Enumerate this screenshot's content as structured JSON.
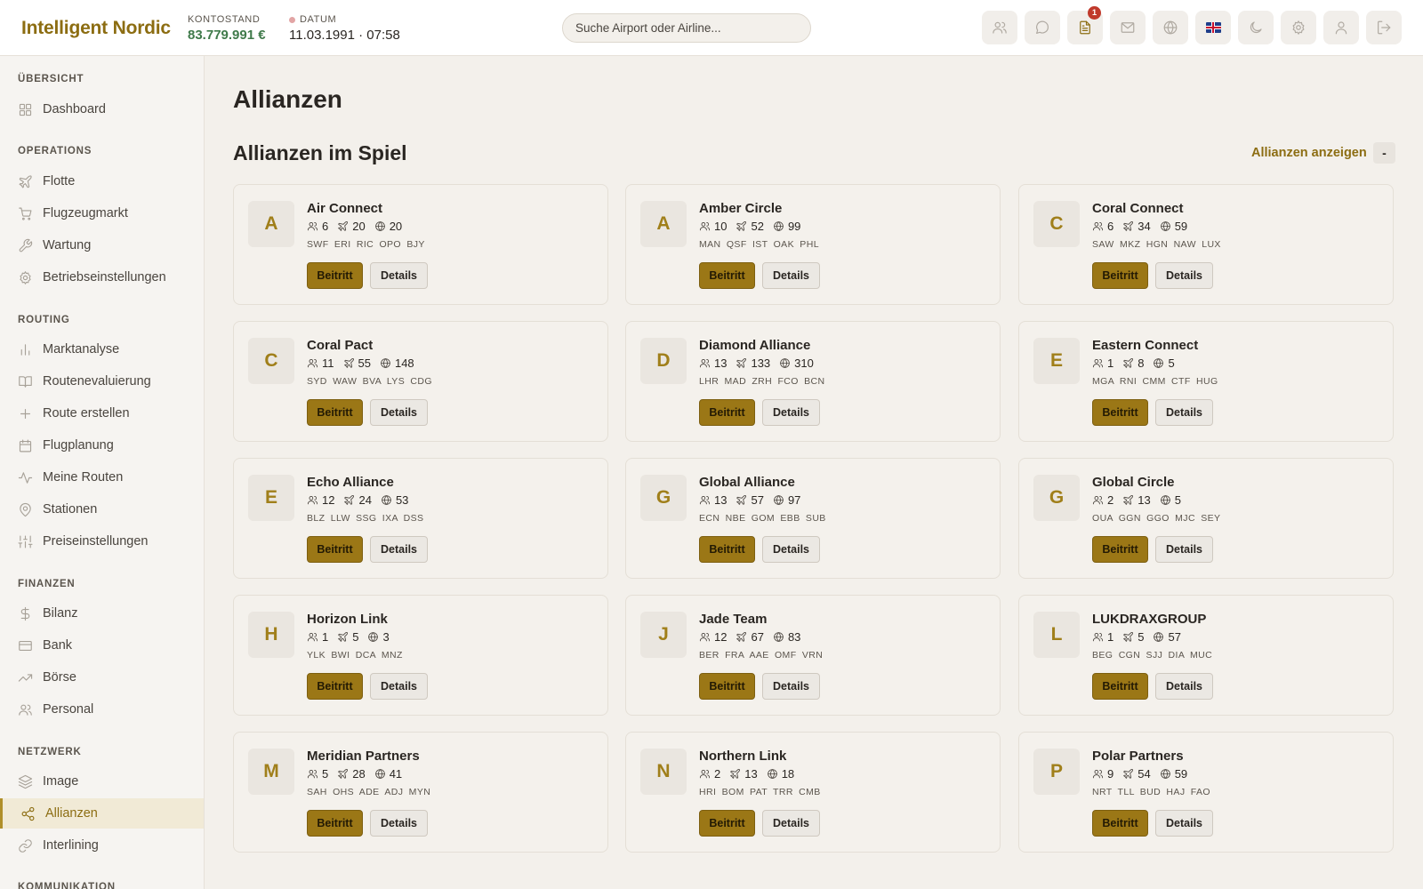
{
  "header": {
    "brand": "Intelligent Nordic",
    "balance_label": "KONTOSTAND",
    "balance_value": "83.779.991 €",
    "date_label": "DATUM",
    "date_value": "11.03.1991 · 07:58",
    "search_placeholder": "Suche Airport oder Airline...",
    "notification_count": "1",
    "icons": [
      "users-icon",
      "chat-icon",
      "document-icon",
      "mail-icon",
      "globe-icon",
      "uk-flag-icon",
      "moon-icon",
      "gear-icon",
      "user-icon",
      "logout-icon"
    ]
  },
  "sidebar": {
    "sections": [
      {
        "title": "ÜBERSICHT",
        "items": [
          {
            "label": "Dashboard",
            "icon": "grid-icon"
          }
        ]
      },
      {
        "title": "OPERATIONS",
        "items": [
          {
            "label": "Flotte",
            "icon": "plane-icon"
          },
          {
            "label": "Flugzeugmarkt",
            "icon": "cart-icon"
          },
          {
            "label": "Wartung",
            "icon": "wrench-icon"
          },
          {
            "label": "Betriebseinstellungen",
            "icon": "gear-icon"
          }
        ]
      },
      {
        "title": "ROUTING",
        "items": [
          {
            "label": "Marktanalyse",
            "icon": "bar-chart-icon"
          },
          {
            "label": "Routenevaluierung",
            "icon": "book-icon"
          },
          {
            "label": "Route erstellen",
            "icon": "plus-icon"
          },
          {
            "label": "Flugplanung",
            "icon": "calendar-icon"
          },
          {
            "label": "Meine Routen",
            "icon": "activity-icon"
          },
          {
            "label": "Stationen",
            "icon": "pin-icon"
          },
          {
            "label": "Preiseinstellungen",
            "icon": "sliders-icon"
          }
        ]
      },
      {
        "title": "FINANZEN",
        "items": [
          {
            "label": "Bilanz",
            "icon": "dollar-icon"
          },
          {
            "label": "Bank",
            "icon": "card-icon"
          },
          {
            "label": "Börse",
            "icon": "trend-icon"
          },
          {
            "label": "Personal",
            "icon": "users-icon"
          }
        ]
      },
      {
        "title": "NETZWERK",
        "items": [
          {
            "label": "Image",
            "icon": "layers-icon"
          },
          {
            "label": "Allianzen",
            "icon": "share-icon",
            "active": true
          },
          {
            "label": "Interlining",
            "icon": "link-icon"
          }
        ]
      },
      {
        "title": "KOMMUNIKATION",
        "items": []
      }
    ]
  },
  "main": {
    "page_title": "Allianzen",
    "section_title": "Allianzen im Spiel",
    "toggle_label": "Allianzen anzeigen",
    "toggle_button": "-",
    "join_label": "Beitritt",
    "details_label": "Details",
    "alliances": [
      {
        "initial": "A",
        "name": "Air Connect",
        "members": "6",
        "fleet": "20",
        "routes": "20",
        "codes": "SWF ERI RIC OPO BJY"
      },
      {
        "initial": "A",
        "name": "Amber Circle",
        "members": "10",
        "fleet": "52",
        "routes": "99",
        "codes": "MAN QSF IST OAK PHL"
      },
      {
        "initial": "C",
        "name": "Coral Connect",
        "members": "6",
        "fleet": "34",
        "routes": "59",
        "codes": "SAW MKZ HGN NAW LUX"
      },
      {
        "initial": "C",
        "name": "Coral Pact",
        "members": "11",
        "fleet": "55",
        "routes": "148",
        "codes": "SYD WAW BVA LYS CDG"
      },
      {
        "initial": "D",
        "name": "Diamond Alliance",
        "members": "13",
        "fleet": "133",
        "routes": "310",
        "codes": "LHR MAD ZRH FCO BCN"
      },
      {
        "initial": "E",
        "name": "Eastern Connect",
        "members": "1",
        "fleet": "8",
        "routes": "5",
        "codes": "MGA RNI CMM CTF HUG"
      },
      {
        "initial": "E",
        "name": "Echo Alliance",
        "members": "12",
        "fleet": "24",
        "routes": "53",
        "codes": "BLZ LLW SSG IXA DSS"
      },
      {
        "initial": "G",
        "name": "Global Alliance",
        "members": "13",
        "fleet": "57",
        "routes": "97",
        "codes": "ECN NBE GOM EBB SUB"
      },
      {
        "initial": "G",
        "name": "Global Circle",
        "members": "2",
        "fleet": "13",
        "routes": "5",
        "codes": "OUA GGN GGO MJC SEY"
      },
      {
        "initial": "H",
        "name": "Horizon Link",
        "members": "1",
        "fleet": "5",
        "routes": "3",
        "codes": "YLK BWI DCA MNZ"
      },
      {
        "initial": "J",
        "name": "Jade Team",
        "members": "12",
        "fleet": "67",
        "routes": "83",
        "codes": "BER FRA AAE OMF VRN"
      },
      {
        "initial": "L",
        "name": "LUKDRAXGROUP",
        "members": "1",
        "fleet": "5",
        "routes": "57",
        "codes": "BEG CGN SJJ DIA MUC"
      },
      {
        "initial": "M",
        "name": "Meridian Partners",
        "members": "5",
        "fleet": "28",
        "routes": "41",
        "codes": "SAH OHS ADE ADJ MYN"
      },
      {
        "initial": "N",
        "name": "Northern Link",
        "members": "2",
        "fleet": "13",
        "routes": "18",
        "codes": "HRI BOM PAT TRR CMB"
      },
      {
        "initial": "P",
        "name": "Polar Partners",
        "members": "9",
        "fleet": "54",
        "routes": "59",
        "codes": "NRT TLL BUD HAJ FAO"
      }
    ]
  },
  "colors": {
    "accent": "#8c6d12",
    "join_button": "#9b7716",
    "balance": "#3f7a4a",
    "badge": "#c0392b"
  }
}
